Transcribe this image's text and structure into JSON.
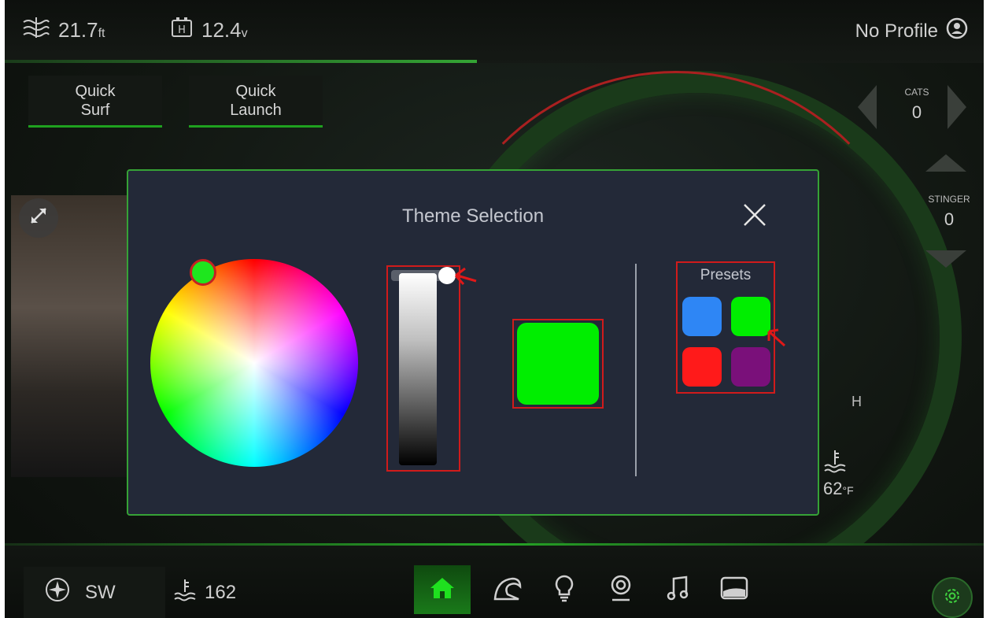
{
  "topbar": {
    "depth_value": "21.7",
    "depth_unit": "ft",
    "voltage_value": "12.4",
    "voltage_unit": "v",
    "profile_label": "No Profile"
  },
  "quick_buttons": [
    {
      "label": "Quick\nSurf"
    },
    {
      "label": "Quick\nLaunch"
    }
  ],
  "side_controls": {
    "cats_label": "CATS",
    "cats_value": "0",
    "stinger_label": "STINGER",
    "stinger_value": "0"
  },
  "gauge": {
    "h_label": "H",
    "temp_value": "62",
    "temp_unit": "°F"
  },
  "bottombar": {
    "heading": "SW",
    "depth": "162",
    "nav_icons": [
      "home-icon",
      "wave-icon",
      "lightbulb-icon",
      "location-icon",
      "music-icon",
      "ballast-icon"
    ],
    "settings_icon": "gear-icon"
  },
  "modal": {
    "title": "Theme Selection",
    "presets_label": "Presets",
    "selected_color": "#00ee00",
    "presets": [
      {
        "color": "#2e86f5"
      },
      {
        "color": "#00ee00"
      },
      {
        "color": "#ff1a1a"
      },
      {
        "color": "#7a107a"
      }
    ]
  },
  "colors": {
    "accent_green": "#36a236",
    "highlight_red": "#d11b1b",
    "modal_bg": "#232938"
  }
}
